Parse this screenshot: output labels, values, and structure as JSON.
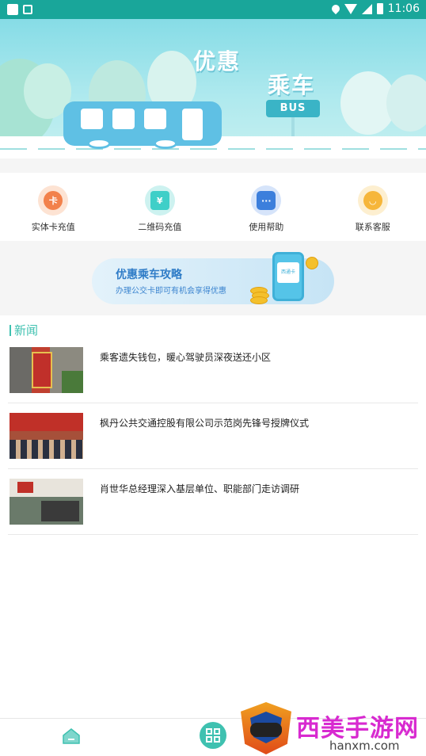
{
  "status_bar": {
    "time": "11:06",
    "icons": [
      "notification-square-icon",
      "app-icon",
      "location-icon",
      "wifi-icon",
      "signal-icon",
      "battery-icon"
    ]
  },
  "banner": {
    "title_line1": "优惠",
    "title_line2": "乘车",
    "bus_stop_sign": "BUS"
  },
  "quick_actions": [
    {
      "label": "实体卡充值",
      "icon": "card-icon",
      "color": "#f2814b",
      "ring": "#fde3d3",
      "glyph": "卡"
    },
    {
      "label": "二维码充值",
      "icon": "wallet-icon",
      "color": "#3fcfc8",
      "ring": "#cdf2f0",
      "glyph": "¥"
    },
    {
      "label": "使用帮助",
      "icon": "chat-icon",
      "color": "#3c7fdc",
      "ring": "#d6e4fa",
      "glyph": "···"
    },
    {
      "label": "联系客服",
      "icon": "headset-icon",
      "color": "#f6b63a",
      "ring": "#fdefd0",
      "glyph": "◡"
    }
  ],
  "promo": {
    "title": "优惠乘车攻略",
    "subtitle": "办理公交卡即可有机会享得优惠",
    "phone_card_text": "西通卡"
  },
  "news": {
    "heading": "新闻",
    "items": [
      {
        "title": "乘客遗失钱包，暖心驾驶员深夜送还小区"
      },
      {
        "title": "枫丹公共交通控股有限公司示范岗先锋号授牌仪式"
      },
      {
        "title": "肖世华总经理深入基层单位、职能部门走访调研"
      }
    ]
  },
  "tab_bar": {
    "home_icon": "home-icon",
    "scan_icon": "qr-code-icon"
  },
  "watermark": {
    "text": "西美手游网",
    "url": "hanxm.com"
  }
}
